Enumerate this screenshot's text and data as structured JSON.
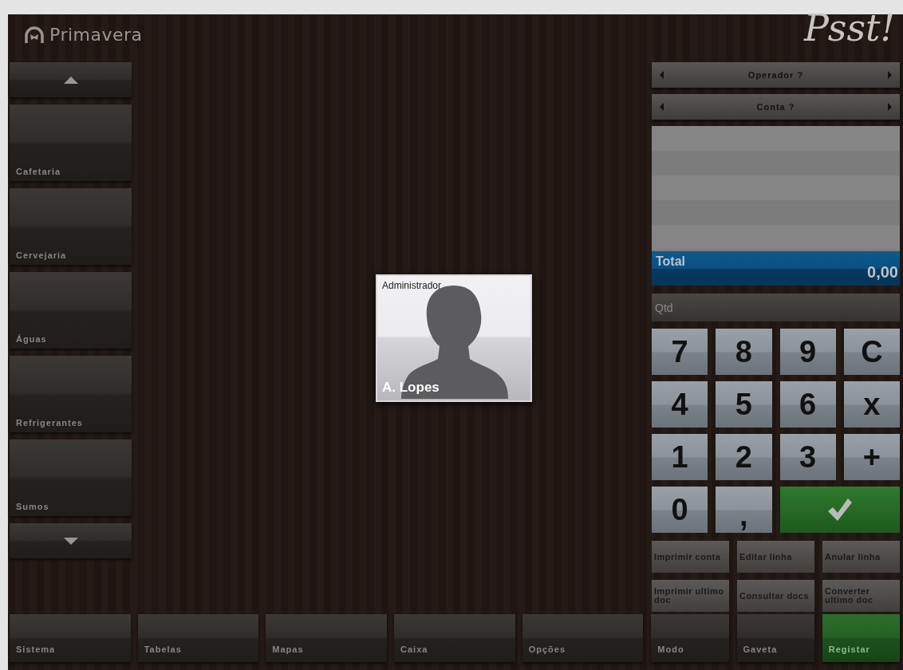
{
  "header": {
    "brand": "Primavera",
    "tagline": "Psst!"
  },
  "categories": [
    {
      "label": "Cafetaria"
    },
    {
      "label": "Cervejaria"
    },
    {
      "label": "Águas"
    },
    {
      "label": "Refrigerantes"
    },
    {
      "label": "Sumos"
    }
  ],
  "user_card": {
    "role": "Administrador",
    "name": "A. Lopes"
  },
  "register": {
    "operator_selector": {
      "label": "Operador ?"
    },
    "account_selector": {
      "label": "Conta ?"
    },
    "total": {
      "label": "Total",
      "value": "0,00"
    },
    "quantity_field": {
      "placeholder": "Qtd"
    },
    "keypad": [
      {
        "kind": "key",
        "label": "7"
      },
      {
        "kind": "key",
        "label": "8"
      },
      {
        "kind": "key",
        "label": "9"
      },
      {
        "kind": "key",
        "label": "C"
      },
      {
        "kind": "key",
        "label": "4"
      },
      {
        "kind": "key",
        "label": "5"
      },
      {
        "kind": "key",
        "label": "6"
      },
      {
        "kind": "key",
        "label": "x"
      },
      {
        "kind": "key",
        "label": "1"
      },
      {
        "kind": "key",
        "label": "2"
      },
      {
        "kind": "key",
        "label": "3"
      },
      {
        "kind": "key",
        "label": "+"
      },
      {
        "kind": "key",
        "label": "0"
      },
      {
        "kind": "key",
        "label": ","
      },
      {
        "kind": "confirm"
      }
    ],
    "actions": [
      {
        "label": "Imprimir conta"
      },
      {
        "label": "Editar linha"
      },
      {
        "label": "Anular linha"
      },
      {
        "label": "Imprimir ultimo doc"
      },
      {
        "label": "Consultar docs"
      },
      {
        "label": "Converter ultimo doc"
      }
    ]
  },
  "bottom_bar": [
    {
      "kind": "menu",
      "label": "Sistema"
    },
    {
      "kind": "menu",
      "label": "Tabelas"
    },
    {
      "kind": "menu",
      "label": "Mapas"
    },
    {
      "kind": "menu",
      "label": "Caixa"
    },
    {
      "kind": "menu",
      "label": "Opções"
    },
    {
      "kind": "small",
      "label": "Modo"
    },
    {
      "kind": "small",
      "label": "Gaveta"
    },
    {
      "kind": "primary",
      "label": "Registar"
    }
  ]
}
